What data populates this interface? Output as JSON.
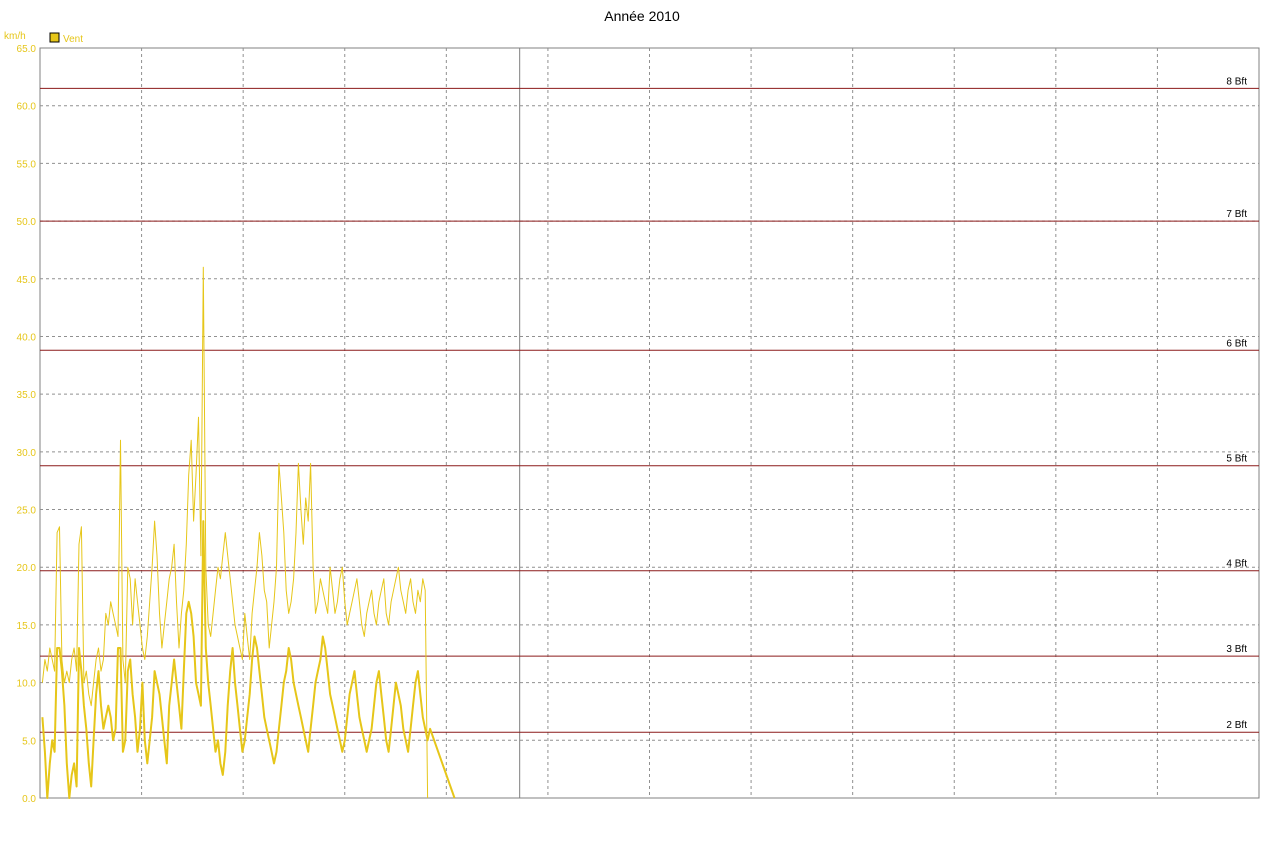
{
  "chart_data": {
    "type": "line",
    "title": "Année 2010",
    "ylabel": "km/h",
    "xlabel": "",
    "ylim": [
      0,
      65
    ],
    "yticks": [
      "0.0",
      "5.0",
      "10.0",
      "15.0",
      "20.0",
      "25.0",
      "30.0",
      "35.0",
      "40.0",
      "45.0",
      "50.0",
      "55.0",
      "60.0",
      "65.0"
    ],
    "grid": true,
    "legend": {
      "position": "top-left",
      "entries": [
        "Vent"
      ]
    },
    "colors": {
      "series": "#e6c619",
      "thresholds": "#8b1a1a",
      "axis_text": "#e6c619",
      "grid": "#808080"
    },
    "x": [
      1,
      2,
      3,
      4,
      5,
      6,
      7,
      8,
      9,
      10,
      11,
      12,
      13,
      14,
      15,
      16,
      17,
      18,
      19,
      20,
      21,
      22,
      23,
      24,
      25,
      26,
      27,
      28,
      29,
      30,
      31,
      32,
      33,
      34,
      35,
      36,
      37,
      38,
      39,
      40,
      41,
      42,
      43,
      44,
      45,
      46,
      47,
      48,
      49,
      50,
      51,
      52,
      53,
      54,
      55,
      56,
      57,
      58,
      59,
      60,
      61,
      62,
      63,
      64,
      65,
      66,
      67,
      68,
      69,
      70,
      71,
      72,
      73,
      74,
      75,
      76,
      77,
      78,
      79,
      80,
      81,
      82,
      83,
      84,
      85,
      86,
      87,
      88,
      89,
      90,
      91,
      92,
      93,
      94,
      95,
      96,
      97,
      98,
      99,
      100,
      101,
      102,
      103,
      104,
      105,
      106,
      107,
      108,
      109,
      110,
      111,
      112,
      113,
      114,
      115,
      116,
      117,
      118,
      119,
      120,
      121,
      122,
      123,
      124,
      125,
      126,
      127,
      128,
      129,
      130,
      131,
      132,
      133,
      134,
      135,
      136,
      137,
      138,
      139,
      140,
      141,
      142,
      143,
      144,
      145,
      146,
      147,
      148,
      149,
      150,
      151,
      152,
      153,
      154,
      155,
      156,
      157,
      158,
      159,
      160,
      170
    ],
    "series": [
      {
        "values": [
          10,
          12,
          11,
          13,
          12,
          11,
          23,
          23.5,
          12,
          10,
          11,
          10,
          12,
          13,
          11,
          22,
          23.5,
          10,
          11,
          9,
          8,
          10,
          12,
          13,
          11,
          12,
          16,
          15,
          17,
          16,
          15,
          14,
          31,
          12,
          10,
          20,
          19,
          15,
          19,
          17,
          15,
          13,
          12,
          14,
          17,
          20,
          24,
          21,
          16,
          13,
          15,
          17,
          19,
          20,
          22,
          17,
          13,
          16,
          18,
          22,
          28,
          31,
          24,
          28,
          33,
          21,
          46,
          20,
          15,
          14,
          16,
          18,
          20,
          19,
          21,
          23,
          21,
          19,
          17,
          15,
          14,
          13,
          12,
          16,
          14,
          12,
          16,
          18,
          20,
          23,
          21,
          18,
          17,
          13,
          15,
          17,
          20,
          29,
          26,
          23,
          18,
          16,
          17,
          19,
          23,
          29,
          25,
          22,
          26,
          24,
          29,
          20,
          16,
          17,
          19,
          18,
          17,
          16,
          20,
          18,
          16,
          17,
          19,
          20,
          17,
          15,
          16,
          17,
          18,
          19,
          17,
          15,
          14,
          16,
          17,
          18,
          16,
          15,
          17,
          18,
          19,
          16,
          15,
          17,
          18,
          19,
          20,
          18,
          17,
          16,
          18,
          19,
          17,
          16,
          18,
          17,
          19,
          18,
          0
        ]
      },
      {
        "values": [
          7,
          4,
          0,
          3,
          5,
          4,
          13,
          13,
          11,
          8,
          3,
          0,
          2,
          3,
          1,
          13,
          11,
          8,
          6,
          3,
          1,
          5,
          9,
          11,
          8,
          6,
          7,
          8,
          7,
          5,
          6,
          13,
          13,
          4,
          5,
          11,
          12,
          9,
          7,
          4,
          6,
          10,
          5,
          3,
          5,
          7,
          11,
          10,
          9,
          7,
          5,
          3,
          8,
          10,
          12,
          10,
          8,
          6,
          11,
          16,
          17,
          16,
          14,
          10,
          9,
          8,
          24,
          13,
          10,
          8,
          6,
          4,
          5,
          3,
          2,
          4,
          8,
          11,
          13,
          10,
          8,
          6,
          4,
          5,
          7,
          9,
          12,
          14,
          13,
          11,
          9,
          7,
          6,
          5,
          4,
          3,
          4,
          6,
          8,
          10,
          11,
          13,
          12,
          10,
          9,
          8,
          7,
          6,
          5,
          4,
          6,
          8,
          10,
          11,
          12,
          14,
          13,
          11,
          9,
          8,
          7,
          6,
          5,
          4,
          5,
          7,
          9,
          10,
          11,
          9,
          7,
          6,
          5,
          4,
          5,
          6,
          8,
          10,
          11,
          9,
          7,
          5,
          4,
          6,
          8,
          10,
          9,
          8,
          6,
          5,
          4,
          6,
          8,
          10,
          11,
          9,
          7,
          6,
          5,
          6,
          0
        ]
      }
    ],
    "threshold_lines": [
      {
        "label": "2 Bft",
        "value": 5.7
      },
      {
        "label": "3 Bft",
        "value": 12.3
      },
      {
        "label": "4 Bft",
        "value": 19.7
      },
      {
        "label": "5 Bft",
        "value": 28.8
      },
      {
        "label": "6 Bft",
        "value": 38.8
      },
      {
        "label": "7 Bft",
        "value": 50.0
      },
      {
        "label": "8 Bft",
        "value": 61.5
      }
    ]
  }
}
